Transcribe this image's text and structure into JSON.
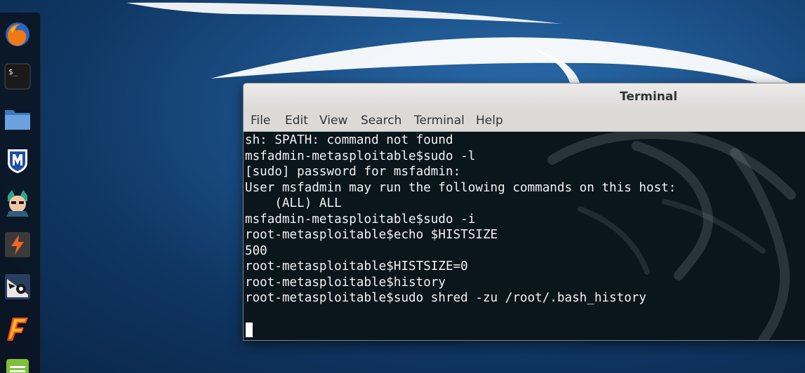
{
  "desktop": {
    "dock": [
      {
        "name": "firefox-icon",
        "color": "#e66000"
      },
      {
        "name": "terminal-icon",
        "glyph": "$_"
      },
      {
        "name": "folder-icon",
        "color": "#5b8fd1"
      },
      {
        "name": "metasploit-icon",
        "color": "#1f4ea3"
      },
      {
        "name": "armitage-icon",
        "color": "#3fae9c"
      },
      {
        "name": "burpsuite-icon",
        "color": "#f26522"
      },
      {
        "name": "maltego-icon",
        "color": "#2b4a7a"
      },
      {
        "name": "faraday-icon",
        "color": "#f04a1e"
      },
      {
        "name": "leafpad-icon",
        "color": "#8cc63f"
      }
    ]
  },
  "terminal": {
    "title": "Terminal",
    "menu": [
      "File",
      "Edit",
      "View",
      "Search",
      "Terminal",
      "Help"
    ],
    "lines": [
      "sh: SPATH: command not found",
      "msfadmin-metasploitable$sudo -l",
      "[sudo] password for msfadmin:",
      "User msfadmin may run the following commands on this host:",
      "    (ALL) ALL",
      "msfadmin-metasploitable$sudo -i",
      "root-metasploitable$echo $HISTSIZE",
      "500",
      "root-metasploitable$HISTSIZE=0",
      "root-metasploitable$history",
      "root-metasploitable$sudo shred -zu /root/.bash_history"
    ],
    "colors": {
      "background": "#0b151c",
      "text": "#f2f2f2",
      "cursor": "#ffffff"
    }
  }
}
